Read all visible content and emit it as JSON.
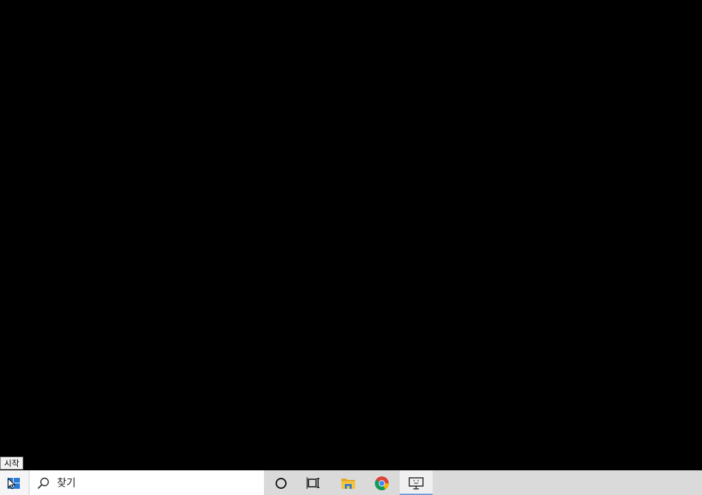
{
  "tooltip": {
    "text": "시작"
  },
  "taskbar": {
    "start_icon": "windows-logo-icon",
    "search": {
      "placeholder": "찾기",
      "icon": "search-icon"
    },
    "buttons": [
      {
        "name": "cortana-button",
        "icon": "cortana-circle-icon"
      },
      {
        "name": "task-view-button",
        "icon": "task-view-icon"
      },
      {
        "name": "file-explorer-button",
        "icon": "folder-icon"
      },
      {
        "name": "chrome-button",
        "icon": "chrome-icon"
      },
      {
        "name": "remote-desktop-button",
        "icon": "monitor-icon",
        "active": true
      }
    ]
  },
  "colors": {
    "desktop": "#000000",
    "taskbar": "#dadada",
    "search_bg": "#ffffff",
    "windows_blue": "#2a7bd6",
    "active_underline": "#6f9fd8"
  }
}
